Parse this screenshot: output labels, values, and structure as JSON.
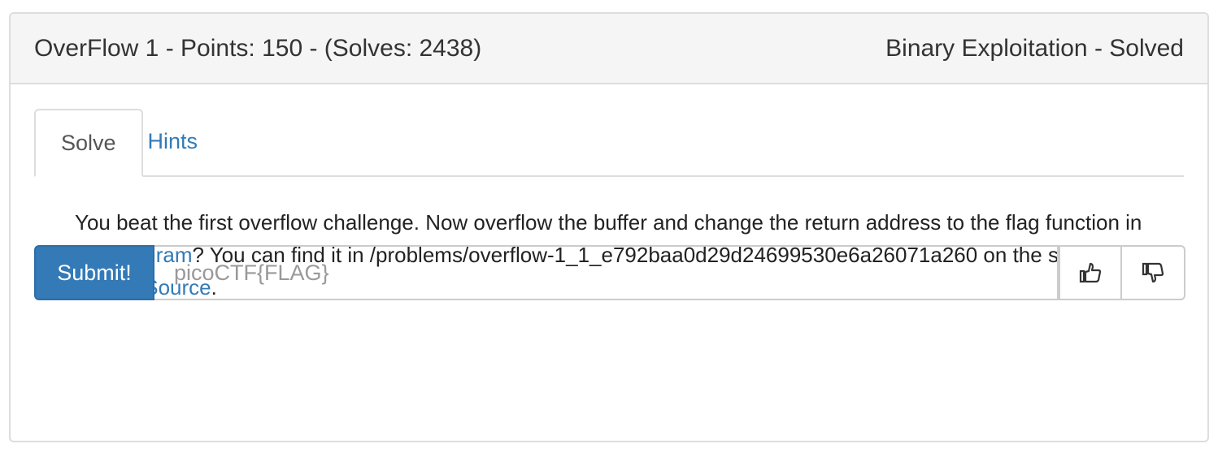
{
  "header": {
    "title": "OverFlow 1 - Points: 150 - (Solves: 2438)",
    "status": "Binary Exploitation - Solved"
  },
  "tabs": [
    {
      "label": "Solve",
      "active": true
    },
    {
      "label": "Hints",
      "active": false
    }
  ],
  "description": {
    "part1": "You beat the first overflow challenge. Now overflow the buffer and change the return address to the flag function in this ",
    "program_link": "program",
    "part2": "? You can find it in /problems/overflow-1_1_e792baa0d29d24699530e6a26071a260 on the shell server. ",
    "source_link": "Source",
    "part3": "."
  },
  "form": {
    "submit_label": "Submit!",
    "flag_placeholder": "picoCTF{FLAG}",
    "flag_value": ""
  },
  "icons": {
    "upvote": "thumbs-up-icon",
    "downvote": "thumbs-down-icon"
  },
  "colors": {
    "accent": "#337ab7",
    "heading_bg": "#f5f5f5",
    "border": "#dddddd"
  }
}
